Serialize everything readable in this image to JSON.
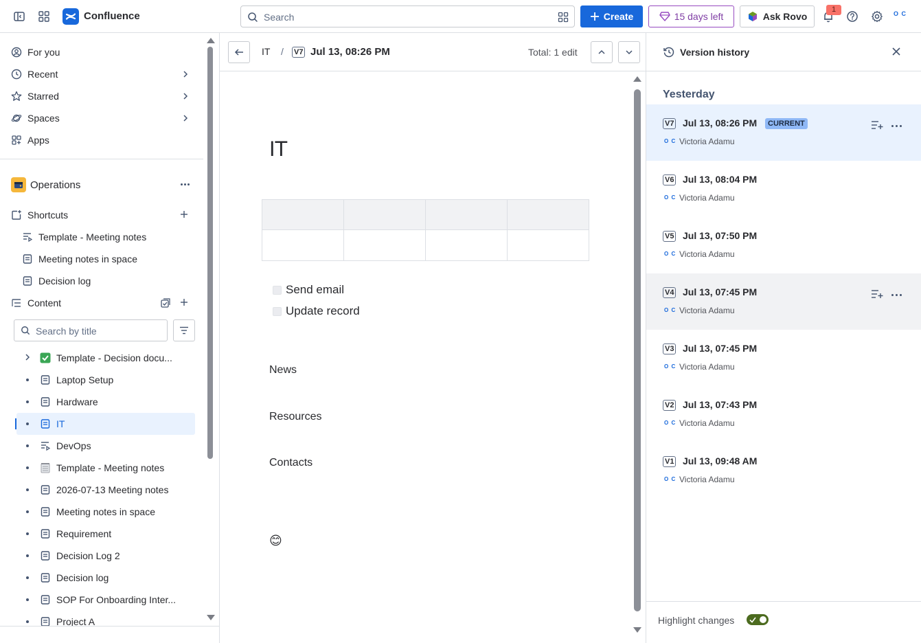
{
  "topbar": {
    "brand": "Confluence",
    "search_placeholder": "Search",
    "create_label": "Create",
    "trial_label": "15 days left",
    "rovo_label": "Ask Rovo",
    "notification_count": "1",
    "avatar_initials": "O C"
  },
  "sidebar": {
    "nav": [
      {
        "label": "For you"
      },
      {
        "label": "Recent"
      },
      {
        "label": "Starred"
      },
      {
        "label": "Spaces"
      },
      {
        "label": "Apps"
      }
    ],
    "space_name": "Operations",
    "shortcuts_label": "Shortcuts",
    "shortcuts": [
      {
        "label": "Template - Meeting notes"
      },
      {
        "label": "Meeting notes in space"
      },
      {
        "label": "Decision log"
      }
    ],
    "content_label": "Content",
    "search_placeholder": "Search by title",
    "tree": [
      {
        "label": "Template - Decision docu..."
      },
      {
        "label": "Laptop Setup"
      },
      {
        "label": "Hardware"
      },
      {
        "label": "IT"
      },
      {
        "label": "DevOps"
      },
      {
        "label": "Template - Meeting notes"
      },
      {
        "label": "2026-07-13 Meeting notes"
      },
      {
        "label": "Meeting notes in space"
      },
      {
        "label": "Requirement"
      },
      {
        "label": "Decision Log 2"
      },
      {
        "label": "Decision log"
      },
      {
        "label": "SOP For Onboarding Inter..."
      },
      {
        "label": "Project A"
      }
    ]
  },
  "content": {
    "breadcrumb_space": "IT",
    "breadcrumb_sep": "/",
    "version_tag": "V7",
    "version_date": "Jul 13, 08:26 PM",
    "total_edits": "Total: 1 edit",
    "page_title": "IT",
    "tasks": [
      "Send email",
      "Update record"
    ],
    "headings": [
      "News",
      "Resources",
      "Contacts"
    ],
    "emoji": "😊"
  },
  "version_history": {
    "title": "Version history",
    "group": "Yesterday",
    "current_label": "CURRENT",
    "versions": [
      {
        "tag": "V7",
        "date": "Jul 13, 08:26 PM",
        "author": "Victoria Adamu",
        "author_initials": "O C"
      },
      {
        "tag": "V6",
        "date": "Jul 13, 08:04 PM",
        "author": "Victoria Adamu",
        "author_initials": "O C"
      },
      {
        "tag": "V5",
        "date": "Jul 13, 07:50 PM",
        "author": "Victoria Adamu",
        "author_initials": "O C"
      },
      {
        "tag": "V4",
        "date": "Jul 13, 07:45 PM",
        "author": "Victoria Adamu",
        "author_initials": "O C"
      },
      {
        "tag": "V3",
        "date": "Jul 13, 07:45 PM",
        "author": "Victoria Adamu",
        "author_initials": "O C"
      },
      {
        "tag": "V2",
        "date": "Jul 13, 07:43 PM",
        "author": "Victoria Adamu",
        "author_initials": "O C"
      },
      {
        "tag": "V1",
        "date": "Jul 13, 09:48 AM",
        "author": "Victoria Adamu",
        "author_initials": "O C"
      }
    ],
    "highlight_label": "Highlight changes"
  },
  "colors": {
    "brand_blue": "#1868db",
    "trial_purple": "#964ac0",
    "selected_bg": "#e9f2fe",
    "toggle_on": "#4c6b1f"
  }
}
